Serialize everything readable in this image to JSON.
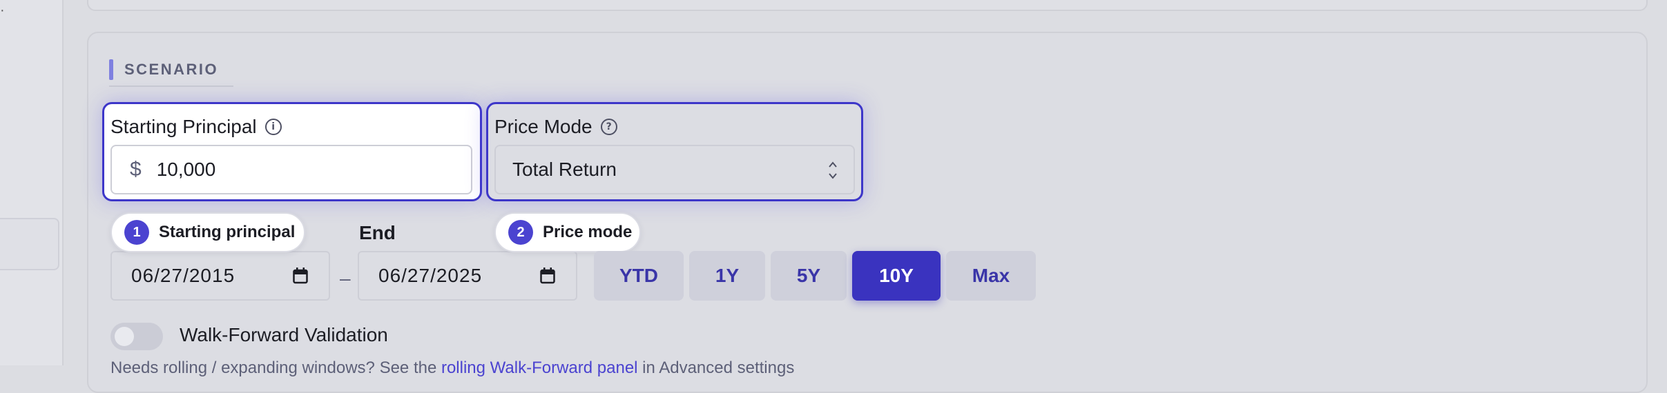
{
  "section": {
    "title": "SCENARIO"
  },
  "principal": {
    "label": "Starting Principal",
    "currency_symbol": "$",
    "value": "10,000",
    "info_icon": "info-icon"
  },
  "price_mode": {
    "label": "Price Mode",
    "selected": "Total Return",
    "help_icon": "question-icon"
  },
  "callouts": [
    {
      "number": "1",
      "text": "Starting principal"
    },
    {
      "number": "2",
      "text": "Price mode"
    }
  ],
  "dates": {
    "end_label": "End",
    "start_value": "06/27/2015",
    "end_value": "06/27/2025",
    "separator": "–"
  },
  "ranges": [
    {
      "label": "YTD",
      "active": false
    },
    {
      "label": "1Y",
      "active": false
    },
    {
      "label": "5Y",
      "active": false
    },
    {
      "label": "10Y",
      "active": true
    },
    {
      "label": "Max",
      "active": false
    }
  ],
  "walk_forward": {
    "label": "Walk-Forward Validation",
    "enabled": false
  },
  "cut_text": {
    "before": "Needs rolling / expanding windows? See the ",
    "link": "rolling Walk-Forward panel",
    "after": " in Advanced settings"
  },
  "colors": {
    "accent": "#3a33bf",
    "highlight_border": "#3d36c9",
    "section_bar": "#7f80e0",
    "background": "#dcdde2"
  }
}
